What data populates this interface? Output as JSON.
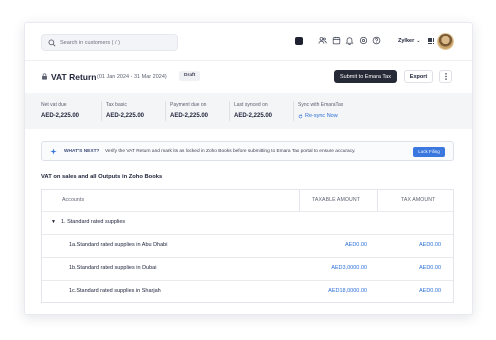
{
  "header": {
    "search_placeholder": "Search in customers ( / )",
    "org_name": "Zylker",
    "org_chevron": "⌄"
  },
  "icons": {
    "search": "search-icon",
    "app": "app-square-icon",
    "users": "users-icon",
    "calendar": "calendar-icon",
    "notifications": "bell-icon",
    "settings": "gear-icon",
    "help": "help-icon",
    "apps_grid": "grid-icon",
    "more": "more-vertical-icon",
    "sparkle": "sparkle-icon",
    "sync": "refresh-icon",
    "lock": "lock-icon"
  },
  "page": {
    "title": "VAT Return",
    "period": "(01 Jan 2024 - 31 Mar 2024)",
    "status": "Draft",
    "submit_label": "Submit to Emara Tax",
    "export_label": "Export"
  },
  "summary": [
    {
      "label": "Net vat due",
      "value": "AED-2,225.00"
    },
    {
      "label": "Tax basic",
      "value": "AED-2,225.00"
    },
    {
      "label": "Payment due on",
      "value": "AED-2,225.00"
    },
    {
      "label": "Last synced on",
      "value": "AED-2,225.00"
    },
    {
      "label": "Sync with EmaraTax",
      "link": "Re-sync Now"
    }
  ],
  "banner": {
    "heading": "WHAT'S NEXT?",
    "message": "Verify the VAT Return and mark its as locked in Zoho Books before submitting to Emara Tax portal to ensure accuracy.",
    "button": "Lock Filing"
  },
  "section_title": "VAT on sales and all  Outputs in Zoho Books",
  "table": {
    "columns": [
      "Accounts",
      "TAXABLE AMOUNT",
      "TAX AMOUNT"
    ],
    "group_toggle": "▼",
    "group": "1.  Standard rated supplies",
    "rows": [
      {
        "account": "1a.Standard rated supplies in Abu Dhabi",
        "taxable": "AED0.00",
        "tax": "AED0.00"
      },
      {
        "account": "1b.Standard rated supplies in Dubai",
        "taxable": "AED3,0000.00",
        "tax": "AED0.00"
      },
      {
        "account": "1c.Standard rated supplies in Sharjah",
        "taxable": "AED18,0000.00",
        "tax": "AED0.00"
      }
    ]
  },
  "colors": {
    "accent": "#2a6fd6",
    "primary_button": "#262a36",
    "banner_button": "#3a78e0",
    "summary_bg": "#f4f5f7"
  }
}
